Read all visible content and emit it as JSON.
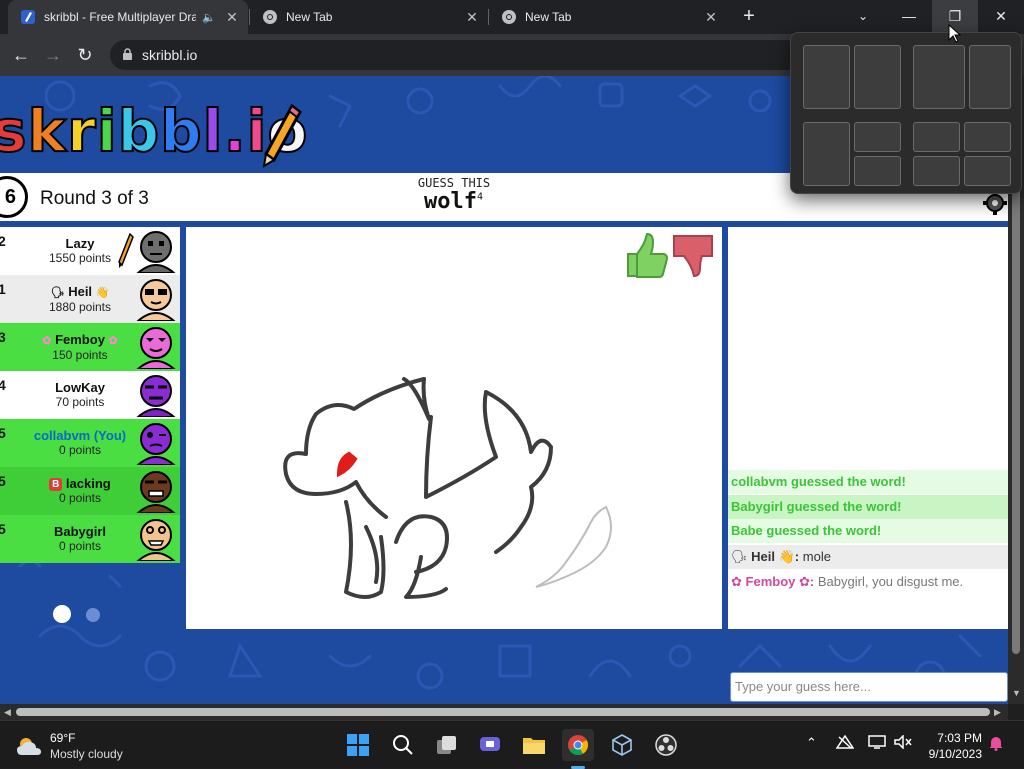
{
  "browser": {
    "tabs": [
      {
        "title": "skribbl - Free Multiplayer Dra",
        "active": true
      },
      {
        "title": "New Tab",
        "active": false
      },
      {
        "title": "New Tab",
        "active": false
      }
    ],
    "url": "skribbl.io"
  },
  "game": {
    "logo_letters": [
      "s",
      "k",
      "r",
      "i",
      "b",
      "b",
      "l",
      ".",
      "i",
      "o"
    ],
    "logo_colors": [
      "#e53b3b",
      "#f07f23",
      "#f6d125",
      "#4cd64b",
      "#3ac7e8",
      "#2f7bf0",
      "#9b4be8",
      "#e93fd5",
      "#f04a8c",
      "#f6f6f6"
    ],
    "timer": "6",
    "round": "Round 3 of 3",
    "guess_label": "GUESS THIS",
    "word": "wolf",
    "word_length": "4",
    "players": [
      {
        "rank": "2",
        "name": "Lazy",
        "points": "1550 points",
        "drawing": true
      },
      {
        "rank": "1",
        "name": "Heil",
        "points": "1880 points"
      },
      {
        "rank": "3",
        "name": "Femboy",
        "points": "150 points"
      },
      {
        "rank": "4",
        "name": "LowKay",
        "points": "70 points"
      },
      {
        "rank": "5",
        "name": "collabvm (You)",
        "points": "0 points"
      },
      {
        "rank": "5",
        "name": "lacking",
        "points": "0 points"
      },
      {
        "rank": "5",
        "name": "Babygirl",
        "points": "0 points"
      }
    ],
    "chat": [
      {
        "text": "collabvm guessed the word!"
      },
      {
        "text": "Babygirl guessed the word!"
      },
      {
        "text": "Babe guessed the word!"
      },
      {
        "name": "Heil",
        "text": "mole"
      },
      {
        "name": "Femboy",
        "text": "Babygirl, you disgust me."
      }
    ],
    "chat_placeholder": "Type your guess here..."
  },
  "taskbar": {
    "temp": "69°F",
    "weather": "Mostly cloudy",
    "time": "7:03 PM",
    "date": "9/10/2023"
  }
}
